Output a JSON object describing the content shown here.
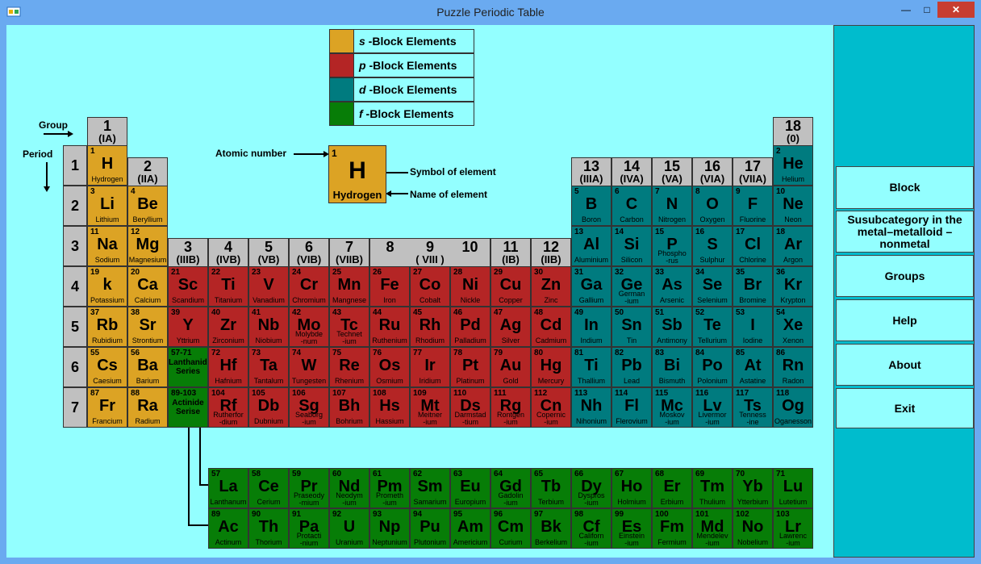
{
  "window": {
    "title": "Puzzle Periodic Table",
    "minimize": "—",
    "maximize": "□",
    "close": "✕"
  },
  "colors": {
    "s": "#dca324",
    "p": "#b42525",
    "d": "#007b7f",
    "f": "#077d07",
    "header": "#c0c0c0",
    "client": "#93ffff",
    "panel": "#00bccd",
    "titlebar": "#6aaaf0"
  },
  "legend": [
    {
      "block": "s",
      "letter": "s",
      "text": " -Block Elements"
    },
    {
      "block": "p",
      "letter": "p",
      "text": " -Block Elements"
    },
    {
      "block": "d",
      "letter": "d",
      "text": " -Block Elements"
    },
    {
      "block": "f",
      "letter": "f",
      "text": " -Block Elements"
    }
  ],
  "labels": {
    "group": "Group",
    "period": "Period",
    "atomic_number": "Atomic number",
    "symbol_of_element": "Symbol of element",
    "name_of_element": "Name of element"
  },
  "sample": {
    "num": "1",
    "sym": "H",
    "name": "Hydrogen"
  },
  "groups": [
    {
      "col": 1,
      "n": "1",
      "r": "(IA)"
    },
    {
      "col": 2,
      "n": "2",
      "r": "(IIA)"
    },
    {
      "col": 3,
      "n": "3",
      "r": "(IIIB)"
    },
    {
      "col": 4,
      "n": "4",
      "r": "(IVB)"
    },
    {
      "col": 5,
      "n": "5",
      "r": "(VB)"
    },
    {
      "col": 6,
      "n": "6",
      "r": "(VIB)"
    },
    {
      "col": 7,
      "n": "7",
      "r": "(VIIB)"
    },
    {
      "col": 8,
      "n": "8",
      "r": ""
    },
    {
      "col": 9,
      "n": "9",
      "r": "( VIII )"
    },
    {
      "col": 10,
      "n": "10",
      "r": ""
    },
    {
      "col": 11,
      "n": "11",
      "r": "(IB)"
    },
    {
      "col": 12,
      "n": "12",
      "r": "(IIB)"
    },
    {
      "col": 13,
      "n": "13",
      "r": "(IIIA)"
    },
    {
      "col": 14,
      "n": "14",
      "r": "(IVA)"
    },
    {
      "col": 15,
      "n": "15",
      "r": "(VA)"
    },
    {
      "col": 16,
      "n": "16",
      "r": "(VIA)"
    },
    {
      "col": 17,
      "n": "17",
      "r": "(VIIA)"
    },
    {
      "col": 18,
      "n": "18",
      "r": "(0)"
    }
  ],
  "periods": [
    "1",
    "2",
    "3",
    "4",
    "5",
    "6",
    "7"
  ],
  "elements": [
    {
      "n": "1",
      "s": "H",
      "name": "Hydrogen",
      "b": "s",
      "row": 1,
      "col": 1
    },
    {
      "n": "2",
      "s": "He",
      "name": "Helium",
      "b": "d",
      "row": 1,
      "col": 18
    },
    {
      "n": "3",
      "s": "Li",
      "name": "Lithium",
      "b": "s",
      "row": 2,
      "col": 1
    },
    {
      "n": "4",
      "s": "Be",
      "name": "Beryllium",
      "b": "s",
      "row": 2,
      "col": 2
    },
    {
      "n": "5",
      "s": "B",
      "name": "Boron",
      "b": "d",
      "row": 2,
      "col": 13
    },
    {
      "n": "6",
      "s": "C",
      "name": "Carbon",
      "b": "d",
      "row": 2,
      "col": 14
    },
    {
      "n": "7",
      "s": "N",
      "name": "Nitrogen",
      "b": "d",
      "row": 2,
      "col": 15
    },
    {
      "n": "8",
      "s": "O",
      "name": "Oxygen",
      "b": "d",
      "row": 2,
      "col": 16
    },
    {
      "n": "9",
      "s": "F",
      "name": "Fluorine",
      "b": "d",
      "row": 2,
      "col": 17
    },
    {
      "n": "10",
      "s": "Ne",
      "name": "Neon",
      "b": "d",
      "row": 2,
      "col": 18
    },
    {
      "n": "11",
      "s": "Na",
      "name": "Sodium",
      "b": "s",
      "row": 3,
      "col": 1
    },
    {
      "n": "12",
      "s": "Mg",
      "name": "Magnesium",
      "b": "s",
      "row": 3,
      "col": 2
    },
    {
      "n": "13",
      "s": "Al",
      "name": "Aluminium",
      "b": "d",
      "row": 3,
      "col": 13
    },
    {
      "n": "14",
      "s": "Si",
      "name": "Silicon",
      "b": "d",
      "row": 3,
      "col": 14
    },
    {
      "n": "15",
      "s": "P",
      "name": "Phospho\n-rus",
      "b": "d",
      "row": 3,
      "col": 15
    },
    {
      "n": "16",
      "s": "S",
      "name": "Sulphur",
      "b": "d",
      "row": 3,
      "col": 16
    },
    {
      "n": "17",
      "s": "Cl",
      "name": "Chlorine",
      "b": "d",
      "row": 3,
      "col": 17
    },
    {
      "n": "18",
      "s": "Ar",
      "name": "Argon",
      "b": "d",
      "row": 3,
      "col": 18
    },
    {
      "n": "19",
      "s": "k",
      "name": "Potassium",
      "b": "s",
      "row": 4,
      "col": 1
    },
    {
      "n": "20",
      "s": "Ca",
      "name": "Calcium",
      "b": "s",
      "row": 4,
      "col": 2
    },
    {
      "n": "21",
      "s": "Sc",
      "name": "Scandium",
      "b": "p",
      "row": 4,
      "col": 3
    },
    {
      "n": "22",
      "s": "Ti",
      "name": "Titanium",
      "b": "p",
      "row": 4,
      "col": 4
    },
    {
      "n": "23",
      "s": "V",
      "name": "Vanadium",
      "b": "p",
      "row": 4,
      "col": 5
    },
    {
      "n": "24",
      "s": "Cr",
      "name": "Chromium",
      "b": "p",
      "row": 4,
      "col": 6
    },
    {
      "n": "25",
      "s": "Mn",
      "name": "Mangnese",
      "b": "p",
      "row": 4,
      "col": 7
    },
    {
      "n": "26",
      "s": "Fe",
      "name": "Iron",
      "b": "p",
      "row": 4,
      "col": 8
    },
    {
      "n": "27",
      "s": "Co",
      "name": "Cobalt",
      "b": "p",
      "row": 4,
      "col": 9
    },
    {
      "n": "28",
      "s": "Ni",
      "name": "Nickle",
      "b": "p",
      "row": 4,
      "col": 10
    },
    {
      "n": "29",
      "s": "Cu",
      "name": "Copper",
      "b": "p",
      "row": 4,
      "col": 11
    },
    {
      "n": "30",
      "s": "Zn",
      "name": "Zinc",
      "b": "p",
      "row": 4,
      "col": 12
    },
    {
      "n": "31",
      "s": "Ga",
      "name": "Gallium",
      "b": "d",
      "row": 4,
      "col": 13
    },
    {
      "n": "32",
      "s": "Ge",
      "name": "German\n-ium",
      "b": "d",
      "row": 4,
      "col": 14
    },
    {
      "n": "33",
      "s": "As",
      "name": "Arsenic",
      "b": "d",
      "row": 4,
      "col": 15
    },
    {
      "n": "34",
      "s": "Se",
      "name": "Selenium",
      "b": "d",
      "row": 4,
      "col": 16
    },
    {
      "n": "35",
      "s": "Br",
      "name": "Bromine",
      "b": "d",
      "row": 4,
      "col": 17
    },
    {
      "n": "36",
      "s": "Kr",
      "name": "Krypton",
      "b": "d",
      "row": 4,
      "col": 18
    },
    {
      "n": "37",
      "s": "Rb",
      "name": "Rubidium",
      "b": "s",
      "row": 5,
      "col": 1
    },
    {
      "n": "38",
      "s": "Sr",
      "name": "Strontium",
      "b": "s",
      "row": 5,
      "col": 2
    },
    {
      "n": "39",
      "s": "Y",
      "name": "Yttrium",
      "b": "p",
      "row": 5,
      "col": 3
    },
    {
      "n": "40",
      "s": "Zr",
      "name": "Zirconium",
      "b": "p",
      "row": 5,
      "col": 4
    },
    {
      "n": "41",
      "s": "Nb",
      "name": "Niobium",
      "b": "p",
      "row": 5,
      "col": 5
    },
    {
      "n": "42",
      "s": "Mo",
      "name": "Molybde\n-num",
      "b": "p",
      "row": 5,
      "col": 6
    },
    {
      "n": "43",
      "s": "Tc",
      "name": "Technet\n-ium",
      "b": "p",
      "row": 5,
      "col": 7
    },
    {
      "n": "44",
      "s": "Ru",
      "name": "Ruthenium",
      "b": "p",
      "row": 5,
      "col": 8
    },
    {
      "n": "45",
      "s": "Rh",
      "name": "Rhodium",
      "b": "p",
      "row": 5,
      "col": 9
    },
    {
      "n": "46",
      "s": "Pd",
      "name": "Palladium",
      "b": "p",
      "row": 5,
      "col": 10
    },
    {
      "n": "47",
      "s": "Ag",
      "name": "Silver",
      "b": "p",
      "row": 5,
      "col": 11
    },
    {
      "n": "48",
      "s": "Cd",
      "name": "Cadmium",
      "b": "p",
      "row": 5,
      "col": 12
    },
    {
      "n": "49",
      "s": "In",
      "name": "Indium",
      "b": "d",
      "row": 5,
      "col": 13
    },
    {
      "n": "50",
      "s": "Sn",
      "name": "Tin",
      "b": "d",
      "row": 5,
      "col": 14
    },
    {
      "n": "51",
      "s": "Sb",
      "name": "Antimony",
      "b": "d",
      "row": 5,
      "col": 15
    },
    {
      "n": "52",
      "s": "Te",
      "name": "Tellurium",
      "b": "d",
      "row": 5,
      "col": 16
    },
    {
      "n": "53",
      "s": "I",
      "name": "Iodine",
      "b": "d",
      "row": 5,
      "col": 17
    },
    {
      "n": "54",
      "s": "Xe",
      "name": "Xenon",
      "b": "d",
      "row": 5,
      "col": 18
    },
    {
      "n": "55",
      "s": "Cs",
      "name": "Caesium",
      "b": "s",
      "row": 6,
      "col": 1
    },
    {
      "n": "56",
      "s": "Ba",
      "name": "Barium",
      "b": "s",
      "row": 6,
      "col": 2
    },
    {
      "n": "57-71",
      "s": "Lanthanids\nSeries",
      "name": "",
      "b": "f",
      "row": 6,
      "col": 3,
      "series": true
    },
    {
      "n": "72",
      "s": "Hf",
      "name": "Hafnium",
      "b": "p",
      "row": 6,
      "col": 4
    },
    {
      "n": "73",
      "s": "Ta",
      "name": "Tantalum",
      "b": "p",
      "row": 6,
      "col": 5
    },
    {
      "n": "74",
      "s": "W",
      "name": "Tungesten",
      "b": "p",
      "row": 6,
      "col": 6
    },
    {
      "n": "75",
      "s": "Re",
      "name": "Rhenium",
      "b": "p",
      "row": 6,
      "col": 7
    },
    {
      "n": "76",
      "s": "Os",
      "name": "Osmium",
      "b": "p",
      "row": 6,
      "col": 8
    },
    {
      "n": "77",
      "s": "Ir",
      "name": "Iridium",
      "b": "p",
      "row": 6,
      "col": 9
    },
    {
      "n": "78",
      "s": "Pt",
      "name": "Platinum",
      "b": "p",
      "row": 6,
      "col": 10
    },
    {
      "n": "79",
      "s": "Au",
      "name": "Gold",
      "b": "p",
      "row": 6,
      "col": 11
    },
    {
      "n": "80",
      "s": "Hg",
      "name": "Mercury",
      "b": "p",
      "row": 6,
      "col": 12
    },
    {
      "n": "81",
      "s": "Ti",
      "name": "Thallium",
      "b": "d",
      "row": 6,
      "col": 13
    },
    {
      "n": "82",
      "s": "Pb",
      "name": "Lead",
      "b": "d",
      "row": 6,
      "col": 14
    },
    {
      "n": "83",
      "s": "Bi",
      "name": "Bismuth",
      "b": "d",
      "row": 6,
      "col": 15
    },
    {
      "n": "84",
      "s": "Po",
      "name": "Polonium",
      "b": "d",
      "row": 6,
      "col": 16
    },
    {
      "n": "85",
      "s": "At",
      "name": "Astatine",
      "b": "d",
      "row": 6,
      "col": 17
    },
    {
      "n": "86",
      "s": "Rn",
      "name": "Radon",
      "b": "d",
      "row": 6,
      "col": 18
    },
    {
      "n": "87",
      "s": "Fr",
      "name": "Francium",
      "b": "s",
      "row": 7,
      "col": 1
    },
    {
      "n": "88",
      "s": "Ra",
      "name": "Radium",
      "b": "s",
      "row": 7,
      "col": 2
    },
    {
      "n": "89-103",
      "s": "Actinide\nSerise",
      "name": "",
      "b": "f",
      "row": 7,
      "col": 3,
      "series": true
    },
    {
      "n": "104",
      "s": "Rf",
      "name": "Rutherfor\n-dium",
      "b": "p",
      "row": 7,
      "col": 4
    },
    {
      "n": "105",
      "s": "Db",
      "name": "Dubnium",
      "b": "p",
      "row": 7,
      "col": 5
    },
    {
      "n": "106",
      "s": "Sg",
      "name": "Seaborg\n-ium",
      "b": "p",
      "row": 7,
      "col": 6
    },
    {
      "n": "107",
      "s": "Bh",
      "name": "Bohrium",
      "b": "p",
      "row": 7,
      "col": 7
    },
    {
      "n": "108",
      "s": "Hs",
      "name": "Hassium",
      "b": "p",
      "row": 7,
      "col": 8
    },
    {
      "n": "109",
      "s": "Mt",
      "name": "Meitner\n-ium",
      "b": "p",
      "row": 7,
      "col": 9
    },
    {
      "n": "110",
      "s": "Ds",
      "name": "Darmstad\n-tium",
      "b": "p",
      "row": 7,
      "col": 10
    },
    {
      "n": "111",
      "s": "Rg",
      "name": "Rontgen\n-ium",
      "b": "p",
      "row": 7,
      "col": 11
    },
    {
      "n": "112",
      "s": "Cn",
      "name": "Copernic\n-ium",
      "b": "p",
      "row": 7,
      "col": 12
    },
    {
      "n": "113",
      "s": "Nh",
      "name": "Nihonium",
      "b": "d",
      "row": 7,
      "col": 13
    },
    {
      "n": "114",
      "s": "Fl",
      "name": "Flerovium",
      "b": "d",
      "row": 7,
      "col": 14
    },
    {
      "n": "115",
      "s": "Mc",
      "name": "Moskov\n-ium",
      "b": "d",
      "row": 7,
      "col": 15
    },
    {
      "n": "116",
      "s": "Lv",
      "name": "Livermor\n-ium",
      "b": "d",
      "row": 7,
      "col": 16
    },
    {
      "n": "117",
      "s": "Ts",
      "name": "Tenness\n-ine",
      "b": "d",
      "row": 7,
      "col": 17
    },
    {
      "n": "118",
      "s": "Og",
      "name": "Oganesson",
      "b": "d",
      "row": 7,
      "col": 18
    },
    {
      "n": "57",
      "s": "La",
      "name": "Lanthanum",
      "b": "f",
      "row": 9,
      "col": 4
    },
    {
      "n": "58",
      "s": "Ce",
      "name": "Cerium",
      "b": "f",
      "row": 9,
      "col": 5
    },
    {
      "n": "59",
      "s": "Pr",
      "name": "Praseody\n-mium",
      "b": "f",
      "row": 9,
      "col": 6
    },
    {
      "n": "60",
      "s": "Nd",
      "name": "Neodym\n-ium",
      "b": "f",
      "row": 9,
      "col": 7
    },
    {
      "n": "61",
      "s": "Pm",
      "name": "Prometh\n-ium",
      "b": "f",
      "row": 9,
      "col": 8
    },
    {
      "n": "62",
      "s": "Sm",
      "name": "Samarium",
      "b": "f",
      "row": 9,
      "col": 9
    },
    {
      "n": "63",
      "s": "Eu",
      "name": "Europium",
      "b": "f",
      "row": 9,
      "col": 10
    },
    {
      "n": "64",
      "s": "Gd",
      "name": "Gadolin\n-ium",
      "b": "f",
      "row": 9,
      "col": 11
    },
    {
      "n": "65",
      "s": "Tb",
      "name": "Terbium",
      "b": "f",
      "row": 9,
      "col": 12
    },
    {
      "n": "66",
      "s": "Dy",
      "name": "Dyspros\n-ium",
      "b": "f",
      "row": 9,
      "col": 13
    },
    {
      "n": "67",
      "s": "Ho",
      "name": "Holmium",
      "b": "f",
      "row": 9,
      "col": 14
    },
    {
      "n": "68",
      "s": "Er",
      "name": "Erbium",
      "b": "f",
      "row": 9,
      "col": 15
    },
    {
      "n": "69",
      "s": "Tm",
      "name": "Thulium",
      "b": "f",
      "row": 9,
      "col": 16
    },
    {
      "n": "70",
      "s": "Yb",
      "name": "Ytterbium",
      "b": "f",
      "row": 9,
      "col": 17
    },
    {
      "n": "71",
      "s": "Lu",
      "name": "Lutetium",
      "b": "f",
      "row": 9,
      "col": 18
    },
    {
      "n": "89",
      "s": "Ac",
      "name": "Actinum",
      "b": "f",
      "row": 10,
      "col": 4
    },
    {
      "n": "90",
      "s": "Th",
      "name": "Thorium",
      "b": "f",
      "row": 10,
      "col": 5
    },
    {
      "n": "91",
      "s": "Pa",
      "name": "Protacti\n-nium",
      "b": "f",
      "row": 10,
      "col": 6
    },
    {
      "n": "92",
      "s": "U",
      "name": "Uranium",
      "b": "f",
      "row": 10,
      "col": 7
    },
    {
      "n": "93",
      "s": "Np",
      "name": "Neptunium",
      "b": "f",
      "row": 10,
      "col": 8
    },
    {
      "n": "94",
      "s": "Pu",
      "name": "Plutonium",
      "b": "f",
      "row": 10,
      "col": 9
    },
    {
      "n": "95",
      "s": "Am",
      "name": "Americium",
      "b": "f",
      "row": 10,
      "col": 10
    },
    {
      "n": "96",
      "s": "Cm",
      "name": "Curium",
      "b": "f",
      "row": 10,
      "col": 11
    },
    {
      "n": "97",
      "s": "Bk",
      "name": "Berkelium",
      "b": "f",
      "row": 10,
      "col": 12
    },
    {
      "n": "98",
      "s": "Cf",
      "name": "Californ\n-ium",
      "b": "f",
      "row": 10,
      "col": 13
    },
    {
      "n": "99",
      "s": "Es",
      "name": "Einstein\n-ium",
      "b": "f",
      "row": 10,
      "col": 14
    },
    {
      "n": "100",
      "s": "Fm",
      "name": "Fermium",
      "b": "f",
      "row": 10,
      "col": 15
    },
    {
      "n": "101",
      "s": "Md",
      "name": "Mendelev\n-ium",
      "b": "f",
      "row": 10,
      "col": 16
    },
    {
      "n": "102",
      "s": "No",
      "name": "Nobelium",
      "b": "f",
      "row": 10,
      "col": 17
    },
    {
      "n": "103",
      "s": "Lr",
      "name": "Lawrenc\n-ium",
      "b": "f",
      "row": 10,
      "col": 18
    }
  ],
  "side_buttons": [
    {
      "id": "block",
      "label": "Block"
    },
    {
      "id": "subcategory",
      "label": "Susubcategory in the metal–metalloid –nonmetal"
    },
    {
      "id": "groups",
      "label": "Groups"
    },
    {
      "id": "help",
      "label": "Help"
    },
    {
      "id": "about",
      "label": "About"
    },
    {
      "id": "exit",
      "label": "Exit"
    }
  ]
}
